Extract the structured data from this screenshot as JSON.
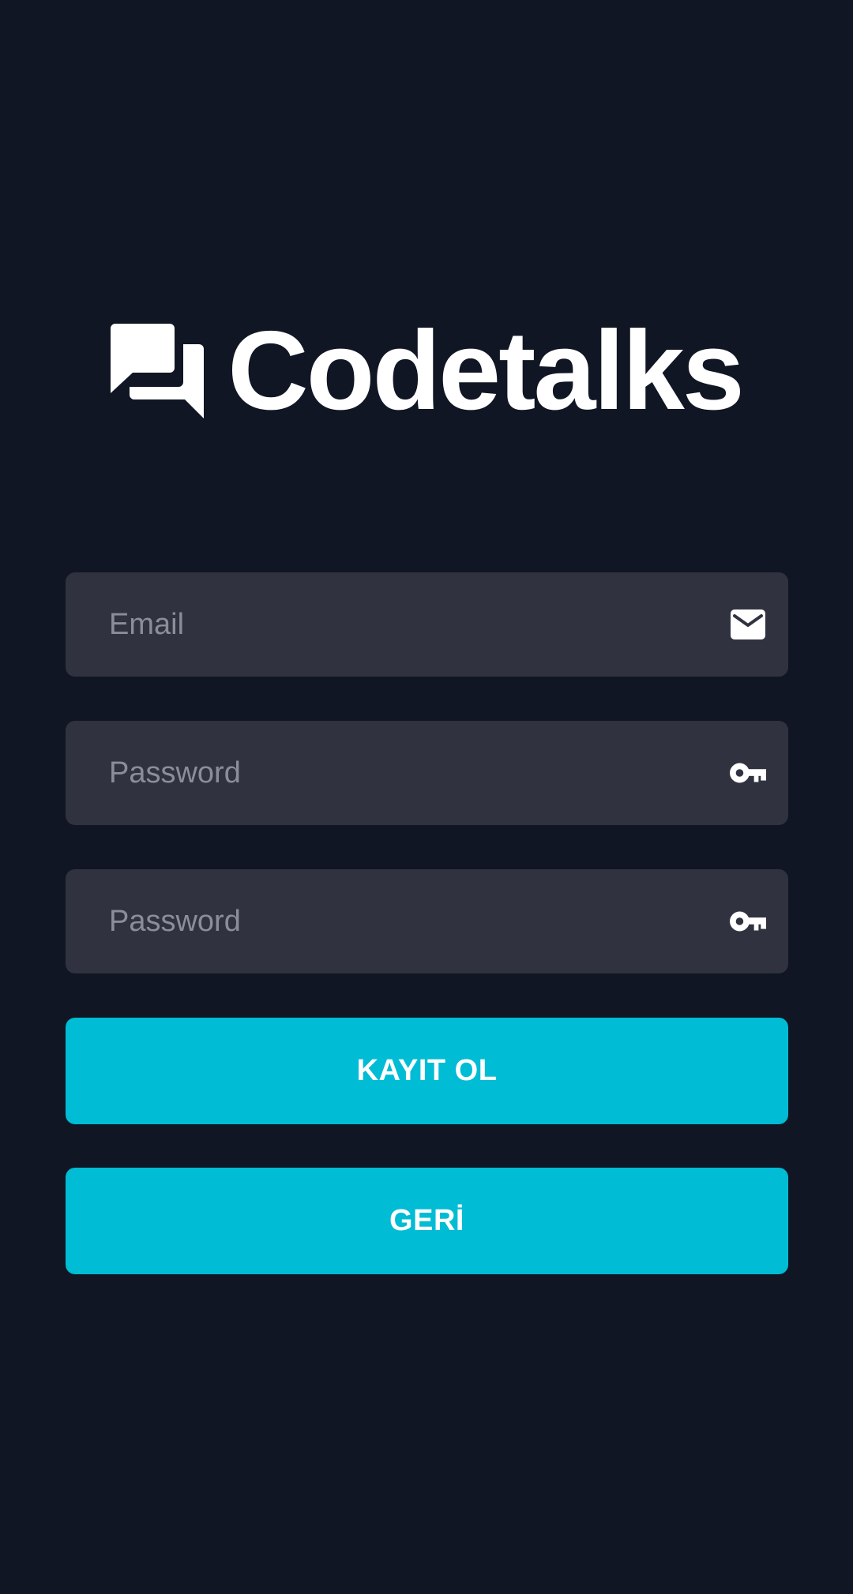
{
  "brand": {
    "name": "Codetalks",
    "icon": "forum-icon"
  },
  "form": {
    "email": {
      "placeholder": "Email",
      "value": "",
      "icon": "email-icon"
    },
    "password": {
      "placeholder": "Password",
      "value": "",
      "icon": "key-icon"
    },
    "password_repeat": {
      "placeholder": "Password",
      "value": "",
      "icon": "key-icon"
    }
  },
  "buttons": {
    "register_label": "KAYIT OL",
    "back_label": "GERİ"
  },
  "colors": {
    "background": "#111624",
    "field_background": "#30333f",
    "placeholder": "#8b8e98",
    "accent": "#00bcd4",
    "text": "#ffffff"
  }
}
